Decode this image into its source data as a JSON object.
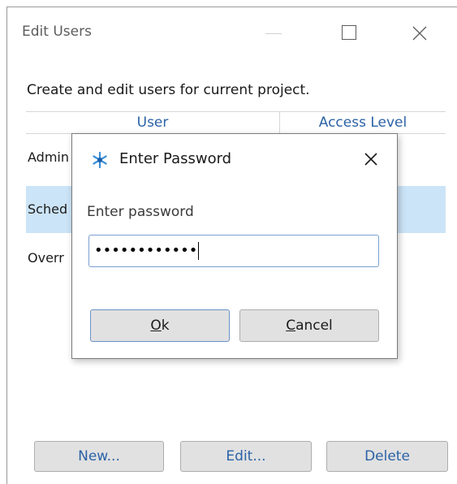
{
  "window": {
    "title": "Edit Users",
    "description": "Create and edit users for current project."
  },
  "table": {
    "columns": [
      "User",
      "Access Level"
    ],
    "rows": [
      {
        "user": "Admin",
        "selected": false
      },
      {
        "user": "Sched",
        "selected": true
      },
      {
        "user": "Overr",
        "selected": false
      }
    ]
  },
  "buttons": {
    "new": "New...",
    "edit": "Edit...",
    "delete": "Delete"
  },
  "dialog": {
    "title": "Enter Password",
    "label": "Enter password",
    "password_masked": "••••••••••••",
    "ok_accel": "O",
    "ok_rest": "k",
    "cancel_accel": "C",
    "cancel_rest": "ancel"
  },
  "colors": {
    "accent_text": "#2b62a6",
    "selection": "#cce4f7"
  },
  "icons": {
    "dialog_icon": "key-asterisk-icon",
    "close": "close-icon",
    "maximize": "maximize-icon",
    "minimize": "minimize-icon"
  }
}
